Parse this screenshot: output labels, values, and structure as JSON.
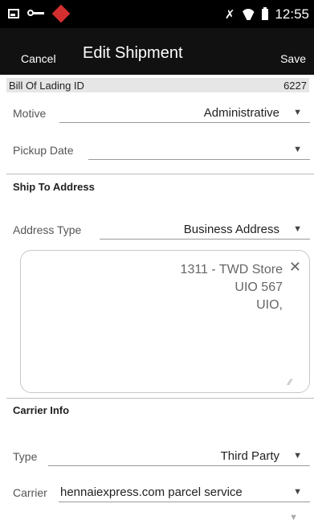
{
  "status_bar": {
    "time": "12:55",
    "icons": [
      "image-icon",
      "key-icon",
      "app-icon",
      "mute-icon",
      "wifi-icon",
      "battery-icon"
    ]
  },
  "toolbar": {
    "cancel_label": "Cancel",
    "title": "Edit Shipment",
    "save_label": "Save"
  },
  "bill_of_lading": {
    "label": "Bill Of Lading ID",
    "value": "6227"
  },
  "fields": {
    "motive": {
      "label": "Motive",
      "value": "Administrative"
    },
    "pickup_date": {
      "label": "Pickup Date",
      "value": ""
    },
    "address_type": {
      "label": "Address Type",
      "value": "Business Address"
    },
    "type": {
      "label": "Type",
      "value": "Third Party"
    },
    "carrier": {
      "label": "Carrier",
      "value": "hennaiexpress.com parcel service"
    }
  },
  "sections": {
    "ship_to": "Ship To Address",
    "carrier_info": "Carrier Info"
  },
  "address": {
    "line1": "1311 - TWD Store",
    "line2": "UIO 567",
    "line3": "UIO,"
  },
  "colors": {
    "toolbar_bg": "#111111",
    "bol_bg": "#e6e6e6",
    "field_line": "#999999"
  }
}
